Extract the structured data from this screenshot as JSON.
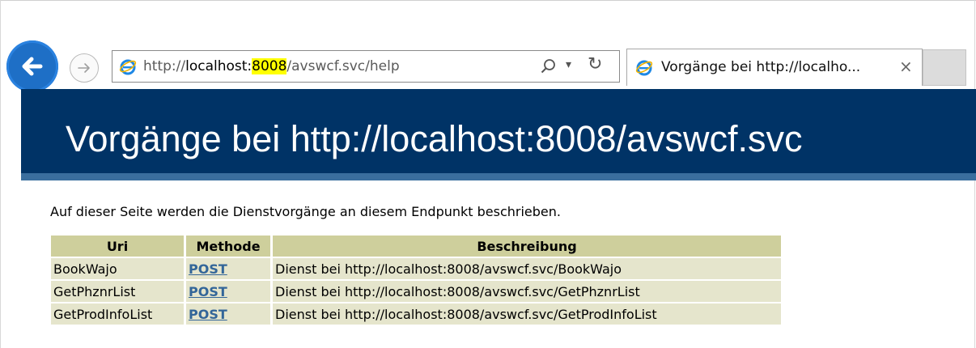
{
  "browser": {
    "url_prefix": "http://",
    "url_host": "localhost:",
    "url_port": "8008",
    "url_path": "/avswcf.svc/help",
    "tab_title": "Vorgänge bei http://localho...",
    "tab_close": "×",
    "icons": [
      "back-arrow-icon",
      "forward-arrow-icon",
      "ie-icon",
      "search-icon",
      "dropdown-icon",
      "refresh-icon",
      "close-icon"
    ]
  },
  "page": {
    "title": "Vorgänge bei http://localhost:8008/avswcf.svc",
    "intro": "Auf dieser Seite werden die Dienstvorgänge an diesem Endpunkt beschrieben.",
    "colors": {
      "banner": "#003366",
      "banner_strip": "#3a6e9e",
      "header_bg": "#cecf9c",
      "cell_bg": "#e5e5cc",
      "link": "#336699"
    }
  },
  "table": {
    "headers": [
      "Uri",
      "Methode",
      "Beschreibung"
    ],
    "rows": [
      {
        "uri": "BookWajo",
        "method": "POST",
        "description": "Dienst bei http://localhost:8008/avswcf.svc/BookWajo"
      },
      {
        "uri": "GetPhznrList",
        "method": "POST",
        "description": "Dienst bei http://localhost:8008/avswcf.svc/GetPhznrList"
      },
      {
        "uri": "GetProdInfoList",
        "method": "POST",
        "description": "Dienst bei http://localhost:8008/avswcf.svc/GetProdInfoList"
      }
    ]
  }
}
